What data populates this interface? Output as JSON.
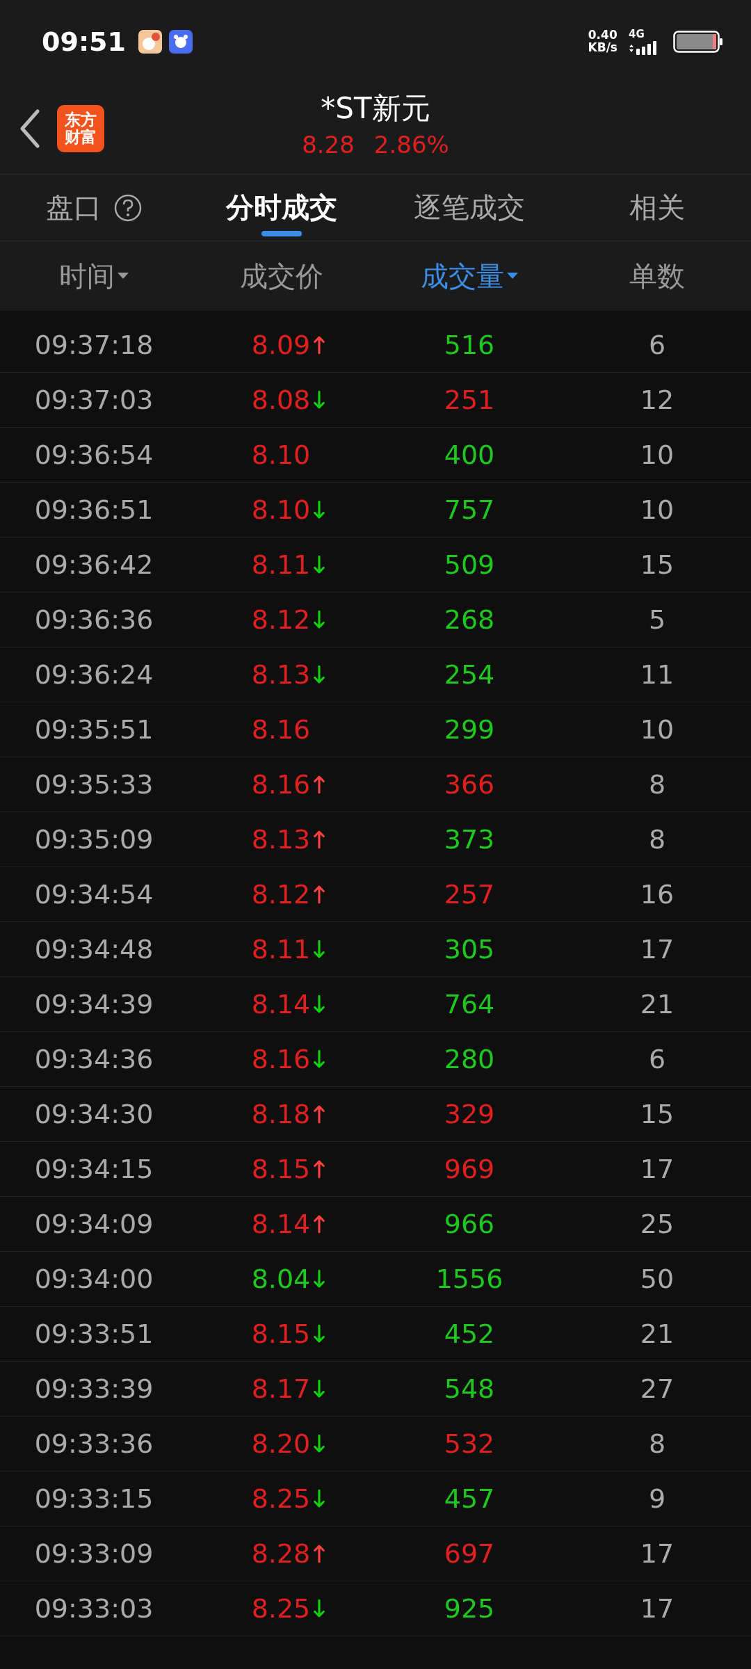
{
  "status_bar": {
    "time": "09:51",
    "net_speed": "0.40",
    "net_unit": "KB/s",
    "network": "4G"
  },
  "header": {
    "logo": [
      "东方",
      "财富"
    ],
    "title": "*ST新元",
    "price": "8.28",
    "change": "2.86%"
  },
  "tabs": [
    {
      "label": "盘口",
      "help": true,
      "selected": false
    },
    {
      "label": "分时成交",
      "help": false,
      "selected": true
    },
    {
      "label": "逐笔成交",
      "help": false,
      "selected": false
    },
    {
      "label": "相关",
      "help": false,
      "selected": false
    }
  ],
  "columns": [
    {
      "label": "时间",
      "sort": true,
      "selected": false
    },
    {
      "label": "成交价",
      "sort": false,
      "selected": false
    },
    {
      "label": "成交量",
      "sort": true,
      "selected": true
    },
    {
      "label": "单数",
      "sort": false,
      "selected": false
    }
  ],
  "rows": [
    {
      "kind": "up",
      "time": "09:37:18",
      "price": {
        "text": "8.09",
        "color": "#e02020"
      },
      "volume": {
        "text": "516",
        "color": "#1ec81e"
      },
      "count": "6"
    },
    {
      "kind": "down",
      "time": "09:37:03",
      "price": {
        "text": "8.08",
        "color": "#e02020"
      },
      "volume": {
        "text": "251",
        "color": "#e02020"
      },
      "count": "12"
    },
    {
      "kind": "flat",
      "time": "09:36:54",
      "price": {
        "text": "8.10",
        "color": "#e02020"
      },
      "volume": {
        "text": "400",
        "color": "#1ec81e"
      },
      "count": "10"
    },
    {
      "kind": "down",
      "time": "09:36:51",
      "price": {
        "text": "8.10",
        "color": "#e02020"
      },
      "volume": {
        "text": "757",
        "color": "#1ec81e"
      },
      "count": "10"
    },
    {
      "kind": "down",
      "time": "09:36:42",
      "price": {
        "text": "8.11",
        "color": "#e02020"
      },
      "volume": {
        "text": "509",
        "color": "#1ec81e"
      },
      "count": "15"
    },
    {
      "kind": "down",
      "time": "09:36:36",
      "price": {
        "text": "8.12",
        "color": "#e02020"
      },
      "volume": {
        "text": "268",
        "color": "#1ec81e"
      },
      "count": "5"
    },
    {
      "kind": "down",
      "time": "09:36:24",
      "price": {
        "text": "8.13",
        "color": "#e02020"
      },
      "volume": {
        "text": "254",
        "color": "#1ec81e"
      },
      "count": "11"
    },
    {
      "kind": "flat",
      "time": "09:35:51",
      "price": {
        "text": "8.16",
        "color": "#e02020"
      },
      "volume": {
        "text": "299",
        "color": "#1ec81e"
      },
      "count": "10"
    },
    {
      "kind": "up",
      "time": "09:35:33",
      "price": {
        "text": "8.16",
        "color": "#e02020"
      },
      "volume": {
        "text": "366",
        "color": "#e02020"
      },
      "count": "8"
    },
    {
      "kind": "up",
      "time": "09:35:09",
      "price": {
        "text": "8.13",
        "color": "#e02020"
      },
      "volume": {
        "text": "373",
        "color": "#1ec81e"
      },
      "count": "8"
    },
    {
      "kind": "up",
      "time": "09:34:54",
      "price": {
        "text": "8.12",
        "color": "#e02020"
      },
      "volume": {
        "text": "257",
        "color": "#e02020"
      },
      "count": "16"
    },
    {
      "kind": "down",
      "time": "09:34:48",
      "price": {
        "text": "8.11",
        "color": "#e02020"
      },
      "volume": {
        "text": "305",
        "color": "#1ec81e"
      },
      "count": "17"
    },
    {
      "kind": "down",
      "time": "09:34:39",
      "price": {
        "text": "8.14",
        "color": "#e02020"
      },
      "volume": {
        "text": "764",
        "color": "#1ec81e"
      },
      "count": "21"
    },
    {
      "kind": "down",
      "time": "09:34:36",
      "price": {
        "text": "8.16",
        "color": "#e02020"
      },
      "volume": {
        "text": "280",
        "color": "#1ec81e"
      },
      "count": "6"
    },
    {
      "kind": "up",
      "time": "09:34:30",
      "price": {
        "text": "8.18",
        "color": "#e02020"
      },
      "volume": {
        "text": "329",
        "color": "#e02020"
      },
      "count": "15"
    },
    {
      "kind": "up",
      "time": "09:34:15",
      "price": {
        "text": "8.15",
        "color": "#e02020"
      },
      "volume": {
        "text": "969",
        "color": "#e02020"
      },
      "count": "17"
    },
    {
      "kind": "up",
      "time": "09:34:09",
      "price": {
        "text": "8.14",
        "color": "#e02020"
      },
      "volume": {
        "text": "966",
        "color": "#1ec81e"
      },
      "count": "25"
    },
    {
      "kind": "down",
      "time": "09:34:00",
      "price": {
        "text": "8.04",
        "color": "#1ec81e"
      },
      "volume": {
        "text": "1556",
        "color": "#1ec81e"
      },
      "count": "50"
    },
    {
      "kind": "down",
      "time": "09:33:51",
      "price": {
        "text": "8.15",
        "color": "#e02020"
      },
      "volume": {
        "text": "452",
        "color": "#1ec81e"
      },
      "count": "21"
    },
    {
      "kind": "down",
      "time": "09:33:39",
      "price": {
        "text": "8.17",
        "color": "#e02020"
      },
      "volume": {
        "text": "548",
        "color": "#1ec81e"
      },
      "count": "27"
    },
    {
      "kind": "down",
      "time": "09:33:36",
      "price": {
        "text": "8.20",
        "color": "#e02020"
      },
      "volume": {
        "text": "532",
        "color": "#e02020"
      },
      "count": "8"
    },
    {
      "kind": "down",
      "time": "09:33:15",
      "price": {
        "text": "8.25",
        "color": "#e02020"
      },
      "volume": {
        "text": "457",
        "color": "#1ec81e"
      },
      "count": "9"
    },
    {
      "kind": "up",
      "time": "09:33:09",
      "price": {
        "text": "8.28",
        "color": "#e02020"
      },
      "volume": {
        "text": "697",
        "color": "#e02020"
      },
      "count": "17"
    },
    {
      "kind": "down",
      "time": "09:33:03",
      "price": {
        "text": "8.25",
        "color": "#e02020"
      },
      "volume": {
        "text": "925",
        "color": "#1ec81e"
      },
      "count": "17"
    }
  ]
}
